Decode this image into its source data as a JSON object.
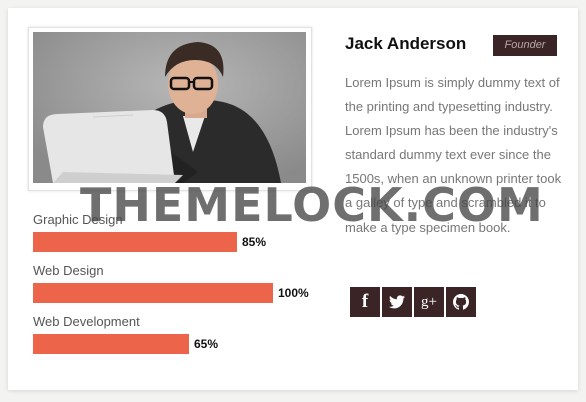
{
  "profile": {
    "name": "Jack Anderson",
    "role": "Founder",
    "bio": "Lorem Ipsum is simply dummy text of the printing and typesetting industry. Lorem Ipsum has been the industry's standard dummy text ever since the 1500s, when an unknown printer took a galley of type and scrambled it to make a type specimen book."
  },
  "skills": [
    {
      "label": "Graphic Design",
      "percent_text": "85%",
      "value": 85
    },
    {
      "label": "Web Design",
      "percent_text": "100%",
      "value": 100
    },
    {
      "label": "Web Development",
      "percent_text": "65%",
      "value": 65
    }
  ],
  "social": [
    {
      "name": "facebook-icon",
      "glyph": "f"
    },
    {
      "name": "twitter-icon",
      "glyph": "t"
    },
    {
      "name": "google-plus-icon",
      "glyph": "g+"
    },
    {
      "name": "github-icon",
      "glyph": "gh"
    }
  ],
  "watermark": "THEMELOCK.COM",
  "colors": {
    "bar": "#ec6449",
    "badge": "#3b2426",
    "social_bg": "#3b2426"
  }
}
